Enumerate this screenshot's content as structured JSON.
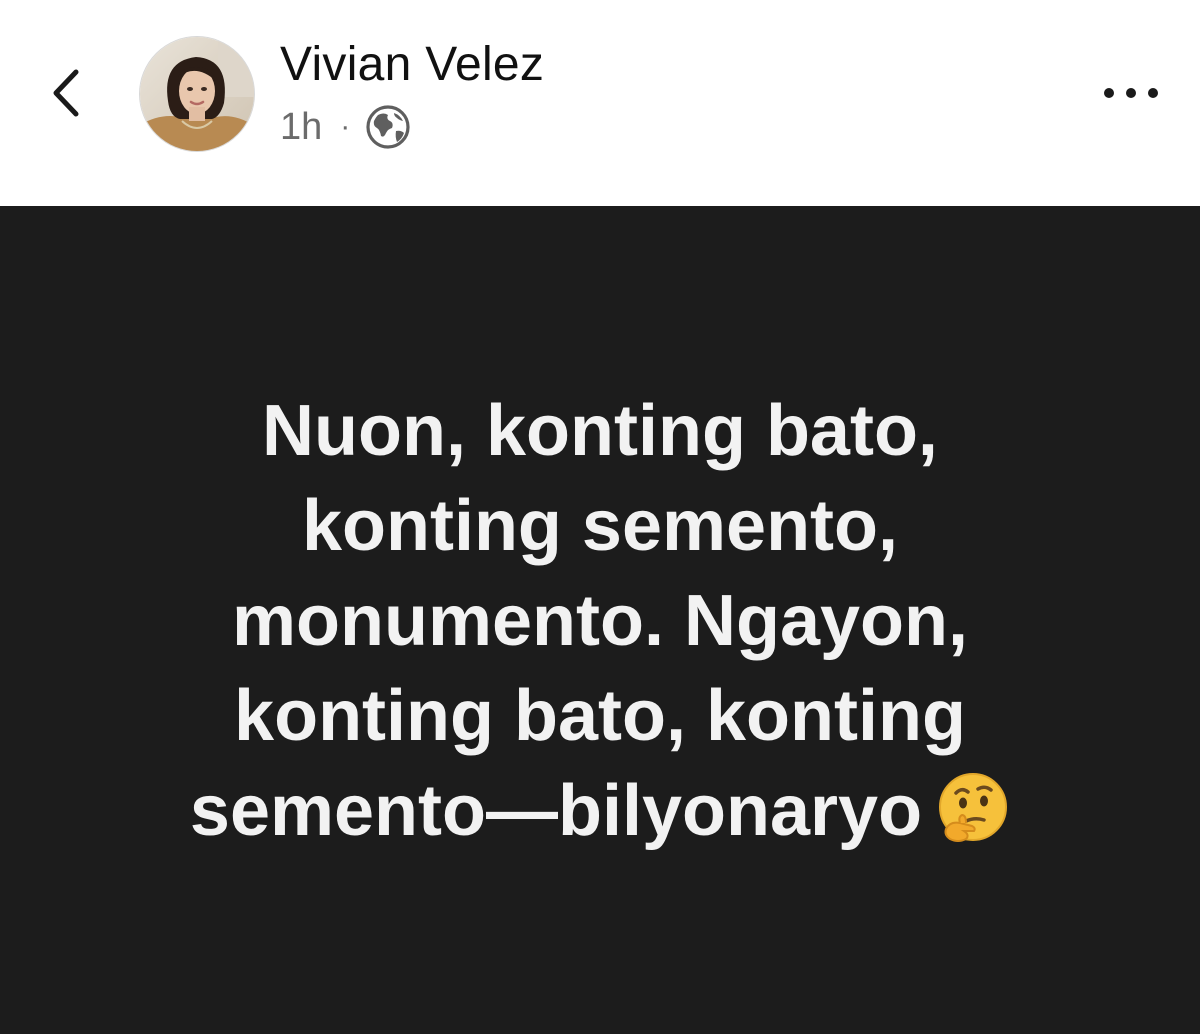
{
  "header": {
    "back_icon": "chevron-left-icon",
    "author_name": "Vivian Velez",
    "timestamp": "1h",
    "separator": "·",
    "audience_icon": "globe-icon",
    "more_icon": "ellipsis-icon"
  },
  "post": {
    "background_color": "#1c1c1c",
    "text_color": "#f2f2f2",
    "lines": [
      "Nuon, konting bato,",
      "konting semento,",
      "monumento. Ngayon,",
      "konting bato, konting",
      "semento—bilyonaryo"
    ],
    "emoji": "thinking-face-icon"
  }
}
